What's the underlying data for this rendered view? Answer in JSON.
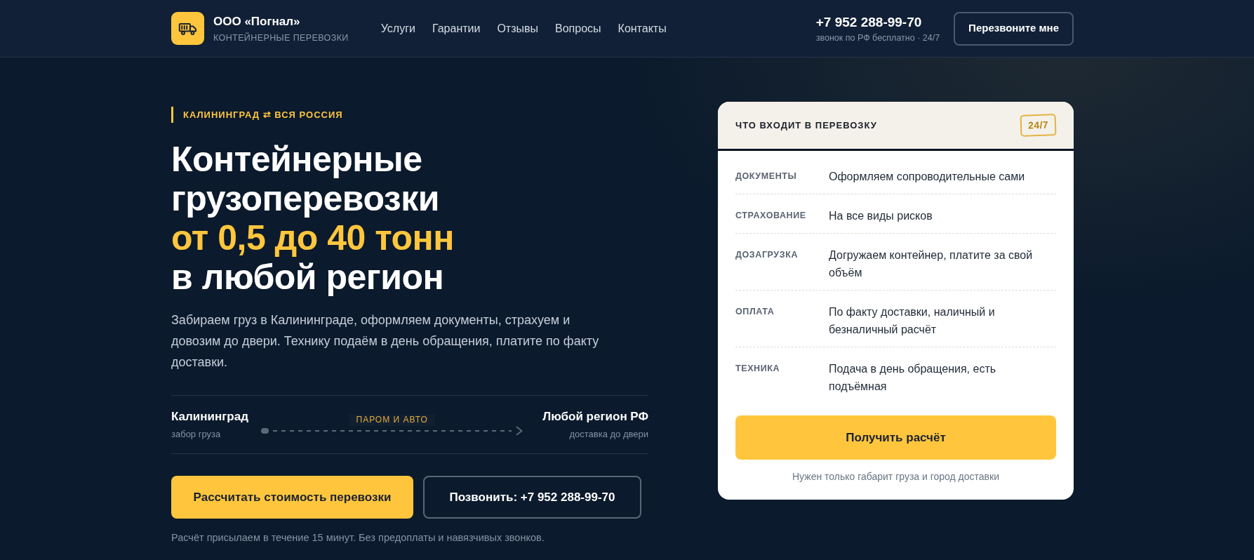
{
  "header": {
    "logo": {
      "name": "ООО «Погнал»",
      "tagline": "КОНТЕЙНЕРНЫЕ ПЕРЕВОЗКИ"
    },
    "nav": [
      "Услуги",
      "Гарантии",
      "Отзывы",
      "Вопросы",
      "Контакты"
    ],
    "phone": "+7 952 288-99-70",
    "phone_note": "звонок по РФ бесплатно · 24/7",
    "callback_button": "Перезвоните мне"
  },
  "hero": {
    "tag": "КАЛИНИНГРАД ⇄ ВСЯ РОССИЯ",
    "title_lines": [
      {
        "text": "Контейнерные",
        "highlight": false
      },
      {
        "text": "грузоперевозки",
        "highlight": false
      },
      {
        "text": "от 0,5 до 40 тонн",
        "highlight": true
      },
      {
        "text": "в любой регион",
        "highlight": false
      }
    ],
    "lead": "Забираем груз в Калининграде, оформляем документы, страхуем и довозим до двери. Технику подаём в день обращения, платите по факту доставки.",
    "route": {
      "from": {
        "city": "Калининград",
        "note": "забор груза"
      },
      "via": "ПАРОМ И АВТО",
      "to": {
        "city": "Любой регион РФ",
        "note": "доставка до двери"
      }
    },
    "buttons": [
      {
        "kind": "primary",
        "label": "Рассчитать стоимость перевозки"
      },
      {
        "kind": "outline",
        "label": "Позвонить: +7 952 288-99-70"
      }
    ],
    "note": "Расчёт присылаем в течение 15 минут. Без предоплаты и навязчивых звонков."
  },
  "card": {
    "title": "ЧТО ВХОДИТ В ПЕРЕВОЗКУ",
    "badge": "24/7",
    "rows": [
      {
        "label": "ДОКУМЕНТЫ",
        "value": "Оформляем сопроводительные сами"
      },
      {
        "label": "СТРАХОВАНИЕ",
        "value": "На все виды рисков"
      },
      {
        "label": "ДОЗАГРУЗКА",
        "value": "Догружаем контейнер, платите за свой объём"
      },
      {
        "label": "ОПЛАТА",
        "value": "По факту доставки, наличный и безналичный расчёт"
      },
      {
        "label": "ТЕХНИКА",
        "value": "Подача в день обращения, есть подъёмная"
      }
    ],
    "button": "Получить расчёт",
    "note": "Нужен только габарит груза и город доставки"
  }
}
